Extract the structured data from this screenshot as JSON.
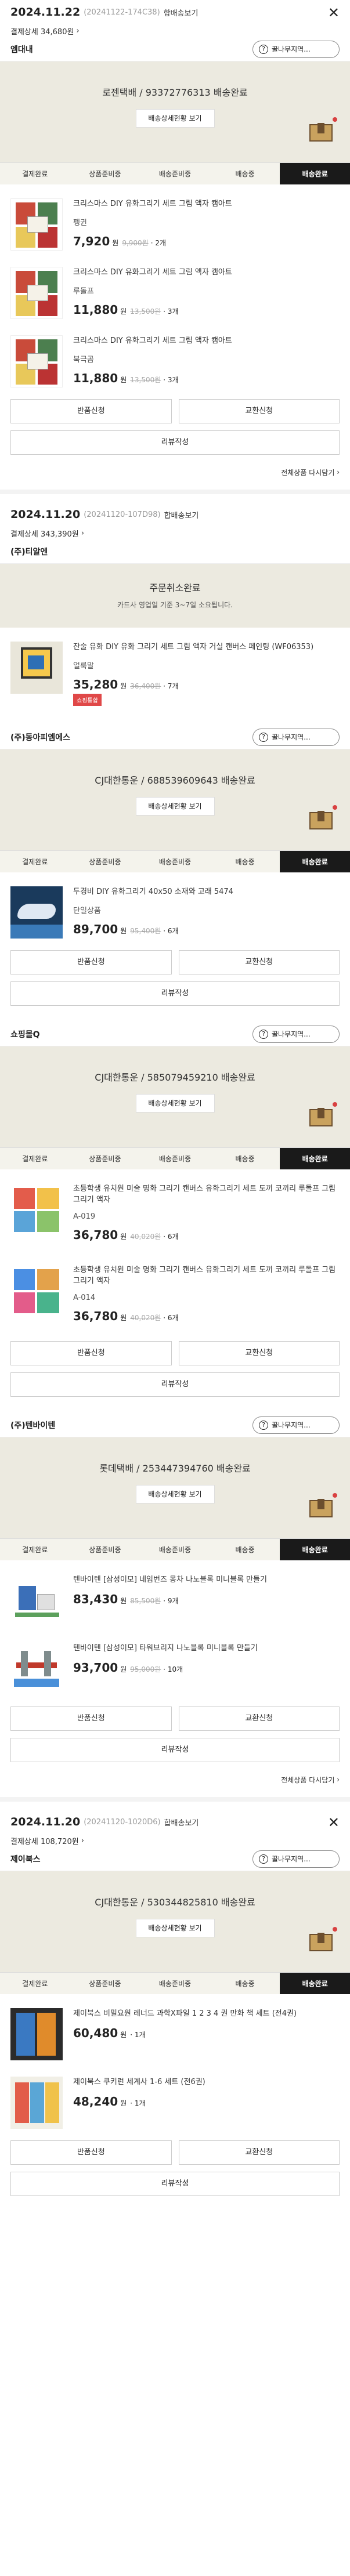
{
  "labels": {
    "merge": "합배송보기",
    "pay_prefix": "결제상세",
    "ask": "꿀나무지역...",
    "detail": "배송상세현황 보기",
    "return": "반품신청",
    "exchange": "교환신청",
    "review": "리뷰작성",
    "reorder": "전체상품 다시담기",
    "won": "원",
    "steps": [
      "결제완료",
      "상품준비중",
      "배송준비중",
      "배송중",
      "배송완료"
    ]
  },
  "orders": [
    {
      "date": "2024.11.22",
      "no": "(20241122-174C38)",
      "pay": "34,680원",
      "groups": [
        {
          "seller": "엠대내",
          "status": "로젠택배 / 93372776313 배송완료",
          "items": [
            {
              "name": "크리스마스 DIY 유화그리기 세트 그림 액자 캠아트",
              "option": "펭귄",
              "price": "7,920",
              "old": "9,900원",
              "qty": "2개"
            },
            {
              "name": "크리스마스 DIY 유화그리기 세트 그림 액자 캠아트",
              "option": "루돌프",
              "price": "11,880",
              "old": "13,500원",
              "qty": "3개"
            },
            {
              "name": "크리스마스 DIY 유화그리기 세트 그림 액자 캠아트",
              "option": "북극곰",
              "price": "11,880",
              "old": "13,500원",
              "qty": "3개"
            }
          ]
        }
      ]
    },
    {
      "date": "2024.11.20",
      "no": "(20241120-107D98)",
      "pay": "343,390원",
      "groups": [
        {
          "seller": "(주)티알엔",
          "cancel_title": "주문취소완료",
          "cancel_sub": "카드사 영업일 기준 3~7일 소요됩니다.",
          "items": [
            {
              "name": "잔술 유화 DIY 유화 그리기 세트 그림 액자 거실 캔버스 페인팅 (WF06353)",
              "option": "얼룩말",
              "price": "35,280",
              "old": "36,400원",
              "qty": "7개",
              "badge": "쇼핑통합"
            }
          ]
        },
        {
          "seller": "(주)동아피엠에스",
          "status": "CJ대한통운 / 688539609643 배송완료",
          "items": [
            {
              "name": "두경비 DIY 유화그리기 40x50 소재와 고래 5474",
              "option": "단일상품",
              "price": "89,700",
              "old": "95,400원",
              "qty": "6개"
            }
          ]
        },
        {
          "seller": "쇼핑몰Q",
          "status": "CJ대한통운 / 585079459210 배송완료",
          "items": [
            {
              "name": "초등학생 유치원 미술 명화 그리기 캔버스 유화그리기 세트 도끼 코끼리 루돌프 그림그리기 액자",
              "option": "A-019",
              "price": "36,780",
              "old": "40,020원",
              "qty": "6개"
            },
            {
              "name": "초등학생 유치원 미술 명화 그리기 캔버스 유화그리기 세트 도끼 코끼리 루돌프 그림그리기 액자",
              "option": "A-014",
              "price": "36,780",
              "old": "40,020원",
              "qty": "6개"
            }
          ]
        },
        {
          "seller": "(주)텐바이텐",
          "status": "롯데택배 / 253447394760 배송완료",
          "reorder": true,
          "items": [
            {
              "name": "텐바이텐 [삼성이모] 네임번즈 몽차 나노블록 미니블록 만들기",
              "option": "",
              "price": "83,430",
              "old": "85,500원",
              "qty": "9개"
            },
            {
              "name": "텐바이텐 [삼성이모] 타워브리지 나노블록 미니블록 만들기",
              "option": "",
              "price": "93,700",
              "old": "95,000원",
              "qty": "10개"
            }
          ]
        }
      ]
    },
    {
      "date": "2024.11.20",
      "no": "(20241120-1020D6)",
      "pay": "108,720원",
      "groups": [
        {
          "seller": "제이북스",
          "status": "CJ대한통운 / 530344825810 배송완료",
          "items": [
            {
              "name": "제이북스 비밀요원 레너드 과학X파일 1 2 3 4 권 만화 책 세트 (전4권)",
              "option": "",
              "price": "60,480",
              "old": "",
              "qty": "1개"
            },
            {
              "name": "제이북스 쿠키런 세계사 1-6 세트 (전6권)",
              "option": "",
              "price": "48,240",
              "old": "",
              "qty": "1개"
            }
          ]
        }
      ]
    }
  ]
}
